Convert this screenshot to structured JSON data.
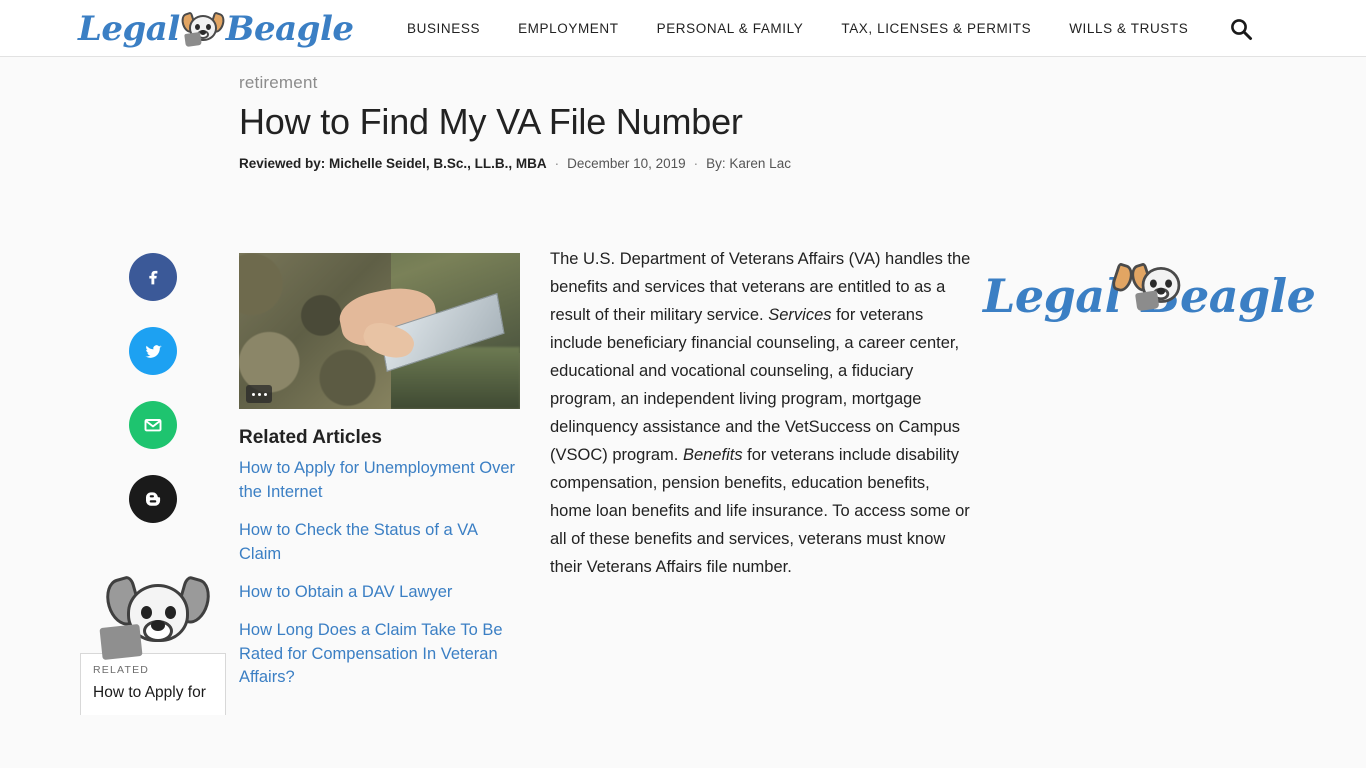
{
  "header": {
    "logo_word_1": "Legal",
    "logo_word_2": "Beagle",
    "nav": [
      {
        "label": "BUSINESS"
      },
      {
        "label": "EMPLOYMENT"
      },
      {
        "label": "PERSONAL & FAMILY"
      },
      {
        "label": "TAX, LICENSES & PERMITS"
      },
      {
        "label": "WILLS & TRUSTS"
      }
    ],
    "search_icon": "search-icon"
  },
  "article": {
    "category": "retirement",
    "title": "How to Find My VA File Number",
    "reviewed_by": "Reviewed by: Michelle Seidel, B.Sc., LL.B., MBA",
    "separator": "·",
    "date": "December 10, 2019",
    "author": "By: Karen Lac",
    "body_1": "The U.S. Department of Veterans Affairs (VA) handles the benefits and services that veterans are entitled to as a result of their military service. ",
    "body_em_1": "Services",
    "body_2": " for veterans include beneficiary financial counseling, a career center, educational and vocational counseling, a fiduciary program, an independent living program, mortgage delinquency assistance and the VetSuccess on Campus (VSOC) program. ",
    "body_em_2": "Benefits",
    "body_3": " for veterans include disability compensation, pension benefits, education benefits, home loan benefits and life insurance. To access some or all of these benefits and services, veterans must know their Veterans Affairs file number.",
    "image_menu_icon": "ellipsis-icon"
  },
  "social": {
    "items": [
      {
        "name": "facebook-share-button",
        "glyph": "f"
      },
      {
        "name": "twitter-share-button",
        "glyph": "🐦"
      },
      {
        "name": "email-share-button",
        "glyph": "✉"
      },
      {
        "name": "blogger-share-button",
        "glyph": "B"
      }
    ]
  },
  "related": {
    "heading": "Related Articles",
    "links": [
      {
        "label": "How to Apply for Unemployment Over the Internet"
      },
      {
        "label": "How to Check the Status of a VA Claim"
      },
      {
        "label": "How to Obtain a DAV Lawyer"
      },
      {
        "label": "How Long Does a Claim Take To Be Rated for Compensation In Veteran Affairs?"
      }
    ]
  },
  "float_card": {
    "label": "RELATED",
    "title": "How to Apply for"
  },
  "colors": {
    "brand_blue": "#3b7fc4",
    "link_blue": "#3b7fc4",
    "facebook": "#3b5998",
    "twitter": "#1da1f2",
    "email_green": "#1ec46f",
    "blogger_black": "#1a1a1a",
    "page_bg": "#fafafa"
  }
}
